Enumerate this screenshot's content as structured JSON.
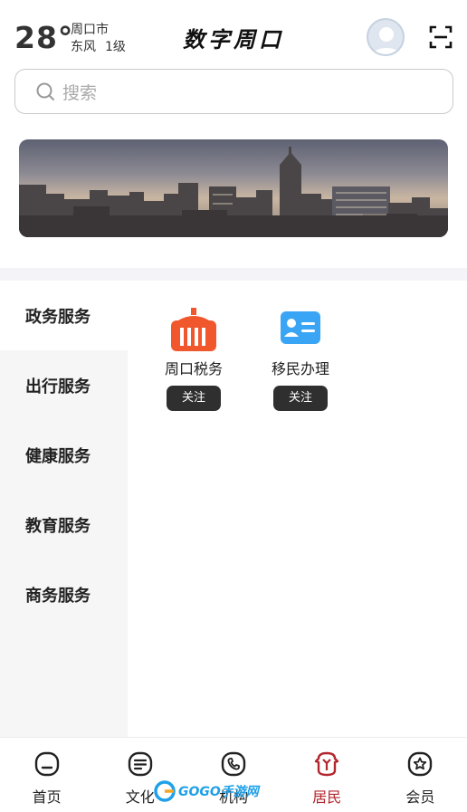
{
  "header": {
    "temperature": "28°",
    "city": "周口市",
    "wind": "东风",
    "wind_level": "1级",
    "app_title": "数字周口"
  },
  "search": {
    "placeholder": "搜索"
  },
  "sidebar": {
    "items": [
      {
        "label": "政务服务",
        "active": true
      },
      {
        "label": "出行服务",
        "active": false
      },
      {
        "label": "健康服务",
        "active": false
      },
      {
        "label": "教育服务",
        "active": false
      },
      {
        "label": "商务服务",
        "active": false
      }
    ]
  },
  "services": [
    {
      "name": "周口税务",
      "action": "关注",
      "icon": "tax-building-icon",
      "color": "#f0572d"
    },
    {
      "name": "移民办理",
      "action": "关注",
      "icon": "id-card-icon",
      "color": "#3aa4f5"
    }
  ],
  "tabbar": {
    "items": [
      {
        "label": "首页",
        "icon": "home-icon",
        "active": false
      },
      {
        "label": "文化",
        "icon": "culture-icon",
        "active": false
      },
      {
        "label": "机构",
        "icon": "phone-icon",
        "active": false
      },
      {
        "label": "居民",
        "icon": "resident-icon",
        "active": true
      },
      {
        "label": "会员",
        "icon": "member-star-icon",
        "active": false
      }
    ]
  },
  "watermark": {
    "text": "GOGO手游网"
  },
  "colors": {
    "accent": "#b3262e",
    "follow_button": "#2f2f2f",
    "sidebar_bg": "#f6f6f6"
  }
}
